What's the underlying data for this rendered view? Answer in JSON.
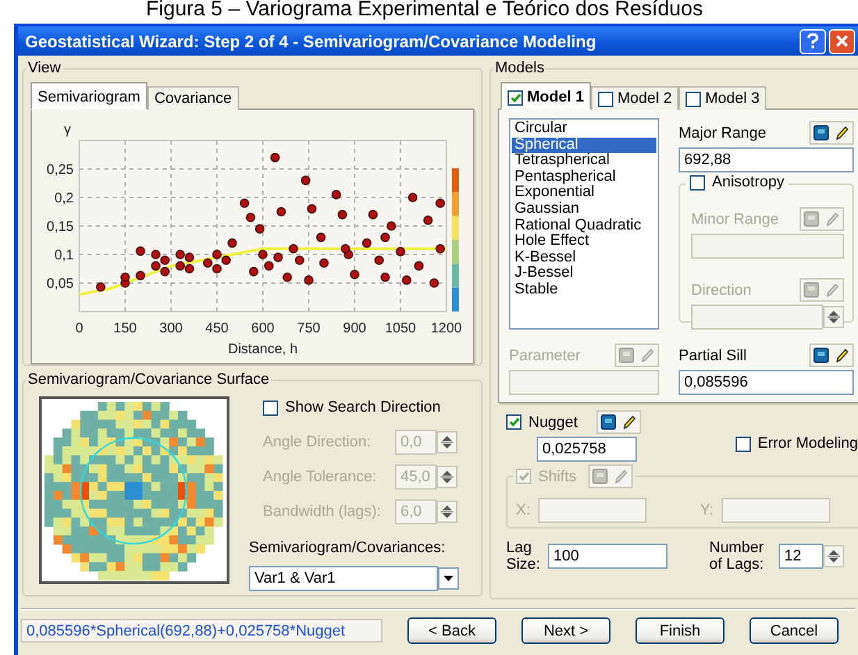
{
  "caption": "Figura 5 – Variograma Experimental e Teórico dos Resíduos",
  "window": {
    "title": "Geostatistical Wizard: Step 2 of 4 - Semivariogram/Covariance Modeling"
  },
  "view": {
    "label": "View",
    "tabs": [
      {
        "label": "Semivariogram",
        "selected": true
      },
      {
        "label": "Covariance",
        "selected": false
      }
    ],
    "chart_data": {
      "type": "scatter",
      "xlabel": "Distance, h",
      "ylabel": "γ",
      "x": [
        70,
        150,
        150,
        200,
        200,
        250,
        250,
        280,
        280,
        330,
        330,
        360,
        360,
        420,
        450,
        450,
        480,
        500,
        540,
        560,
        570,
        590,
        600,
        620,
        640,
        660,
        680,
        700,
        720,
        740,
        750,
        760,
        790,
        800,
        840,
        860,
        880,
        900,
        940,
        960,
        980,
        1000,
        1020,
        1050,
        1070,
        1090,
        1110,
        1140,
        1160,
        1180,
        1180,
        1000,
        870,
        650
      ],
      "series": [
        {
          "type": "scatter",
          "color": "#b01010",
          "values": [
            0.043,
            0.05,
            0.06,
            0.063,
            0.106,
            0.08,
            0.1,
            0.07,
            0.09,
            0.08,
            0.1,
            0.075,
            0.095,
            0.085,
            0.075,
            0.1,
            0.09,
            0.12,
            0.19,
            0.165,
            0.07,
            0.145,
            0.1,
            0.08,
            0.27,
            0.175,
            0.06,
            0.11,
            0.09,
            0.23,
            0.055,
            0.18,
            0.13,
            0.085,
            0.205,
            0.17,
            0.1,
            0.065,
            0.12,
            0.17,
            0.09,
            0.06,
            0.15,
            0.105,
            0.055,
            0.2,
            0.08,
            0.16,
            0.05,
            0.19,
            0.11,
            0.13,
            0.11,
            0.095
          ]
        },
        {
          "type": "line",
          "color": "#f0f040",
          "x": [
            0,
            100,
            200,
            300,
            400,
            500,
            600,
            700,
            800,
            1200
          ],
          "values": [
            0.03,
            0.04,
            0.06,
            0.08,
            0.09,
            0.1,
            0.11,
            0.11,
            0.11,
            0.11
          ]
        }
      ],
      "xlim": [
        0,
        1200
      ],
      "ylim": [
        0,
        0.3
      ],
      "grid": true,
      "xticks": [
        0,
        150,
        300,
        450,
        600,
        750,
        900,
        1050,
        1200
      ],
      "yticks": [
        {
          "value": 0.05,
          "label": "0,05"
        },
        {
          "value": 0.1,
          "label": "0,1"
        },
        {
          "value": 0.15,
          "label": "0,15"
        },
        {
          "value": 0.2,
          "label": "0,2"
        },
        {
          "value": 0.25,
          "label": "0,25"
        }
      ]
    }
  },
  "surface": {
    "label": "Semivariogram/Covariance Surface",
    "show_search_direction": {
      "label": "Show Search Direction",
      "checked": false
    },
    "angles": [
      {
        "label": "Angle Direction:",
        "value": "0,0",
        "disabled": true
      },
      {
        "label": "Angle Tolerance:",
        "value": "45,0",
        "disabled": true
      },
      {
        "label": "Bandwidth (lags):",
        "value": "6,0",
        "disabled": true
      }
    ],
    "covariances": {
      "label": "Semivariogram/Covariances:",
      "value": "Var1 & Var1"
    }
  },
  "models": {
    "label": "Models",
    "tabs": [
      {
        "label": "Model 1",
        "checked": true,
        "selected": true
      },
      {
        "label": "Model 2",
        "checked": false,
        "selected": false
      },
      {
        "label": "Model 3",
        "checked": false,
        "selected": false
      }
    ],
    "types": [
      {
        "label": "Circular",
        "selected": false
      },
      {
        "label": "Spherical",
        "selected": true
      },
      {
        "label": "Tetraspherical",
        "selected": false
      },
      {
        "label": "Pentaspherical",
        "selected": false
      },
      {
        "label": "Exponential",
        "selected": false
      },
      {
        "label": "Gaussian",
        "selected": false
      },
      {
        "label": "Rational Quadratic",
        "selected": false
      },
      {
        "label": "Hole Effect",
        "selected": false
      },
      {
        "label": "K-Bessel",
        "selected": false
      },
      {
        "label": "J-Bessel",
        "selected": false
      },
      {
        "label": "Stable",
        "selected": false
      }
    ],
    "major_range": {
      "label": "Major Range",
      "value": "692,88",
      "disabled": false
    },
    "anisotropy": {
      "label": "Anisotropy",
      "checked": false
    },
    "minor_range": {
      "label": "Minor Range",
      "disabled": true
    },
    "direction": {
      "label": "Direction",
      "disabled": true
    },
    "parameter": {
      "label": "Parameter",
      "disabled": true
    },
    "partial_sill": {
      "label": "Partial Sill",
      "value": "0,085596",
      "disabled": false
    },
    "nugget": {
      "label": "Nugget",
      "checked": true,
      "value": "0,025758"
    },
    "error_modeling": {
      "label": "Error Modeling",
      "checked": false
    },
    "shifts": {
      "label": "Shifts",
      "checked": true,
      "disabled": true,
      "x_label": "X:",
      "y_label": "Y:"
    },
    "lag_size": {
      "label": "Lag Size:",
      "value": "100"
    },
    "number_of_lags": {
      "label": "Number of Lags:",
      "value": "12"
    }
  },
  "formula": "0,085596*Spherical(692,88)+0,025758*Nugget",
  "buttons": [
    {
      "label": "< Back"
    },
    {
      "label": "Next >"
    },
    {
      "label": "Finish"
    },
    {
      "label": "Cancel"
    }
  ]
}
